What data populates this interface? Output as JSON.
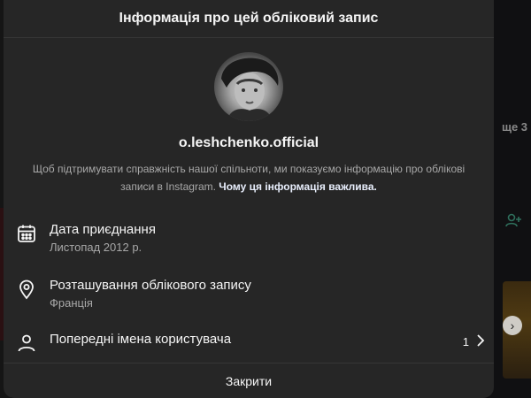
{
  "dialog": {
    "title": "Інформація про цей обліковий запис",
    "username": "o.leshchenko.official",
    "description": "Щоб підтримувати справжність нашої спільноти, ми показуємо інформацію про облікові записи в Instagram.",
    "description_link": "Чому ця інформація важлива.",
    "rows": [
      {
        "icon": "calendar-icon",
        "title": "Дата приєднання",
        "subtitle": "Листопад 2012 р."
      },
      {
        "icon": "location-pin-icon",
        "title": "Розташування облікового запису",
        "subtitle": "Франція"
      },
      {
        "icon": "person-icon",
        "title": "Попередні імена користувача",
        "count": "1"
      }
    ],
    "close_label": "Закрити"
  },
  "background": {
    "right_text": "ще 3"
  }
}
